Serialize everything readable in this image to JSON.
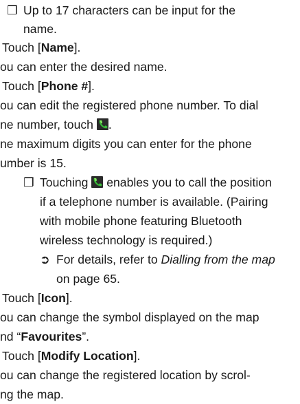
{
  "note1": {
    "bullet": "❒",
    "line1": "Up to 17 characters can be input for the",
    "line2": "name."
  },
  "step_name": {
    "pre": "Touch [",
    "bold": "Name",
    "post": "]."
  },
  "name_desc": "ou can enter the desired name.",
  "step_phone": {
    "pre": "Touch [",
    "bold": "Phone #",
    "post": "]."
  },
  "phone_desc": {
    "line1": "ou can edit the registered phone number. To dial",
    "line2_pre": "ne number, touch",
    "line2_post": "."
  },
  "max_digits": {
    "line1": "ne maximum digits you can enter for the phone",
    "line2": "umber is 15."
  },
  "note2": {
    "bullet": "❒",
    "line1_pre": "Touching",
    "line1_post": "enables you to call the position",
    "line2": "if a telephone number is available. (Pairing",
    "line3": "with mobile phone featuring Bluetooth",
    "line4": "wireless technology is required.)"
  },
  "ref": {
    "arrow": "➲",
    "pre": "For details, refer to ",
    "italic": "Dialling from the map",
    "line2": "on page 65."
  },
  "step_icon": {
    "pre": "Touch [",
    "bold": "Icon",
    "post": "]."
  },
  "icon_desc": {
    "line1": "ou can change the symbol displayed on the map",
    "line2_pre": "nd “",
    "line2_bold": "Favourites",
    "line2_post": "”."
  },
  "step_modify": {
    "pre": "Touch [",
    "bold": "Modify Location",
    "post": "]."
  },
  "modify_desc": {
    "line1": "ou can change the registered location by scrol-",
    "line2": "ng the map."
  }
}
